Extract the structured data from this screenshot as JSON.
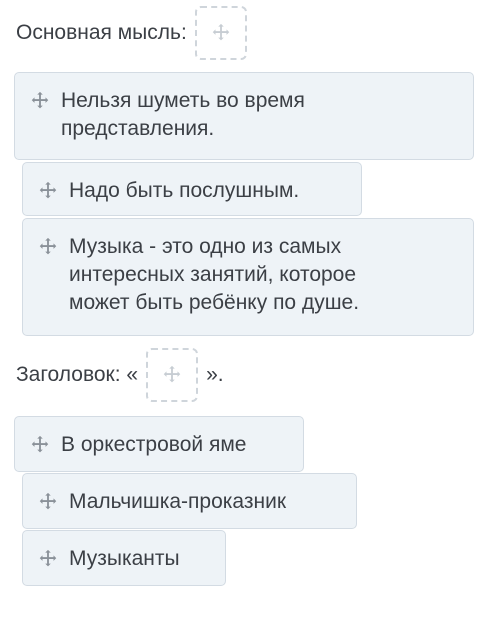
{
  "main_idea": {
    "label": "Основная мысль:",
    "cards": [
      {
        "text": "Нельзя шуметь во время представления."
      },
      {
        "text": "Надо быть послушным."
      },
      {
        "text": "Музыка - это одно из самых интересных занятий, которое может быть ребёнку по душе."
      }
    ]
  },
  "title": {
    "label_prefix": "Заголовок: «",
    "label_suffix": "».",
    "cards": [
      {
        "text": "В оркестровой яме"
      },
      {
        "text": "Мальчишка-проказник"
      },
      {
        "text": "Музыканты"
      }
    ]
  },
  "colors": {
    "card_bg": "#eef3f7",
    "card_border": "#d3dbe3",
    "slot_border": "#cfd5db"
  },
  "icons": {
    "drag": "move-icon"
  }
}
